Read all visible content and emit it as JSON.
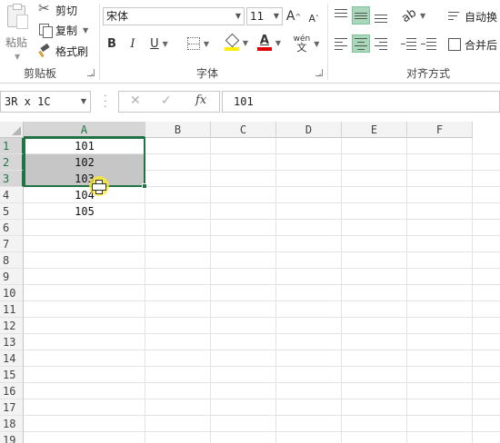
{
  "ribbon": {
    "clipboard": {
      "paste_label": "粘贴",
      "cut_label": "剪切",
      "copy_label": "复制",
      "format_painter_label": "格式刷",
      "group_label": "剪贴板"
    },
    "font": {
      "font_name": "宋体",
      "font_size": "11",
      "bold": "B",
      "italic": "I",
      "underline": "U",
      "grow": "A",
      "shrink": "A",
      "font_color_glyph": "A",
      "phonetic_top": "wén",
      "phonetic_bottom": "文",
      "group_label": "字体"
    },
    "alignment": {
      "wrap_text_label": "自动换",
      "merge_label": "合并后",
      "group_label": "对齐方式"
    }
  },
  "formula_bar": {
    "name_box": "3R x 1C",
    "cancel_glyph": "✕",
    "enter_glyph": "✓",
    "fx_label": "fx",
    "formula": "101"
  },
  "grid": {
    "columns": [
      "A",
      "B",
      "C",
      "D",
      "E",
      "F"
    ],
    "rows": [
      "1",
      "2",
      "3",
      "4",
      "5",
      "6",
      "7",
      "8",
      "9",
      "10",
      "11",
      "12",
      "13",
      "14",
      "15",
      "16",
      "17",
      "18",
      "19"
    ],
    "column_a_values": [
      "101",
      "102",
      "103",
      "104",
      "105"
    ],
    "selected_range": "A1:A3"
  },
  "colors": {
    "accent": "#217346",
    "selection_fill": "#c6c6c6",
    "active_align": "#a8d8b9",
    "cursor_highlight": "#ffec28"
  }
}
